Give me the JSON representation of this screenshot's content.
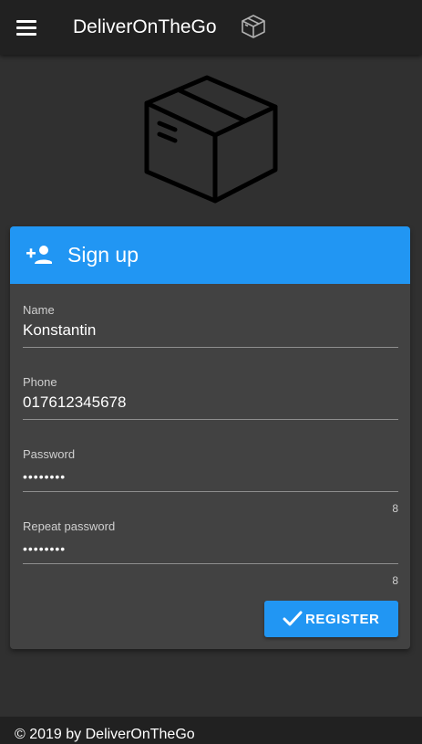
{
  "app": {
    "title": "DeliverOnTheGo"
  },
  "colors": {
    "toolbar": "#212121",
    "background": "#303030",
    "card": "#424242",
    "accent": "#2196F3"
  },
  "icons": {
    "menu": "menu-icon",
    "toolbar_logo": "package-box-icon",
    "hero": "package-box-icon",
    "card_header": "person-add-icon",
    "register": "checkmark-icon"
  },
  "signup": {
    "title": "Sign up",
    "fields": [
      {
        "label": "Name",
        "value": "Konstantin"
      },
      {
        "label": "Phone",
        "value": "017612345678"
      },
      {
        "label": "Password",
        "value": "••••••••",
        "counter": "8"
      },
      {
        "label": "Repeat password",
        "value": "••••••••",
        "counter": "8"
      }
    ],
    "register_label": "REGISTER"
  },
  "footer": {
    "text": "© 2019 by DeliverOnTheGo"
  }
}
